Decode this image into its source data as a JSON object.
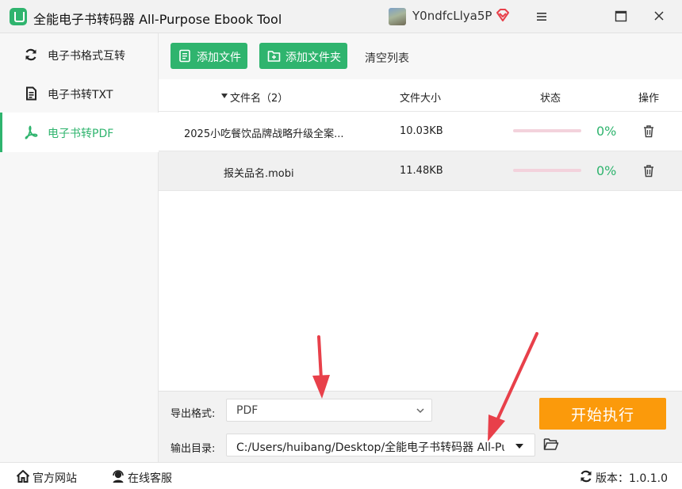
{
  "window": {
    "title": "全能电子书转码器 All-Purpose Ebook Tool",
    "username": "Y0ndfcLlya5P",
    "icons": {
      "logo": "app-logo-icon",
      "vip": "vip-diamond-icon",
      "menu": "hamburger-menu-icon",
      "maximize": "maximize-icon",
      "close": "close-icon"
    }
  },
  "sidebar": {
    "items": [
      {
        "label": "电子书格式互转",
        "icon": "refresh-icon",
        "active": false
      },
      {
        "label": "电子书转TXT",
        "icon": "document-icon",
        "active": false
      },
      {
        "label": "电子书转PDF",
        "icon": "pdf-icon",
        "active": true
      }
    ]
  },
  "toolbar": {
    "add_file_label": "添加文件",
    "add_folder_label": "添加文件夹",
    "clear_label": "清空列表"
  },
  "table": {
    "headers": {
      "name": "文件名（2）",
      "size": "文件大小",
      "status": "状态",
      "action": "操作"
    },
    "rows": [
      {
        "name": "2025小吃餐饮品牌战略升级全案...",
        "size": "10.03KB",
        "progress": 0,
        "progress_label": "0%"
      },
      {
        "name": "报关品名.mobi",
        "size": "11.48KB",
        "progress": 0,
        "progress_label": "0%"
      }
    ]
  },
  "output": {
    "format_label": "导出格式:",
    "format_value": "PDF",
    "dir_label": "输出目录:",
    "dir_value": "C:/Users/huibang/Desktop/全能电子书转码器 All-Purpose Ebook Tool",
    "start_label": "开始执行"
  },
  "statusbar": {
    "website_label": "官方网站",
    "support_label": "在线客服",
    "version_label": "版本：",
    "version_value": "1.0.1.0"
  },
  "colors": {
    "accent": "#2fb46e",
    "start_button": "#fb9a0b",
    "progress_track": "#f3d2dc",
    "annotation_arrow": "#e8404a"
  }
}
